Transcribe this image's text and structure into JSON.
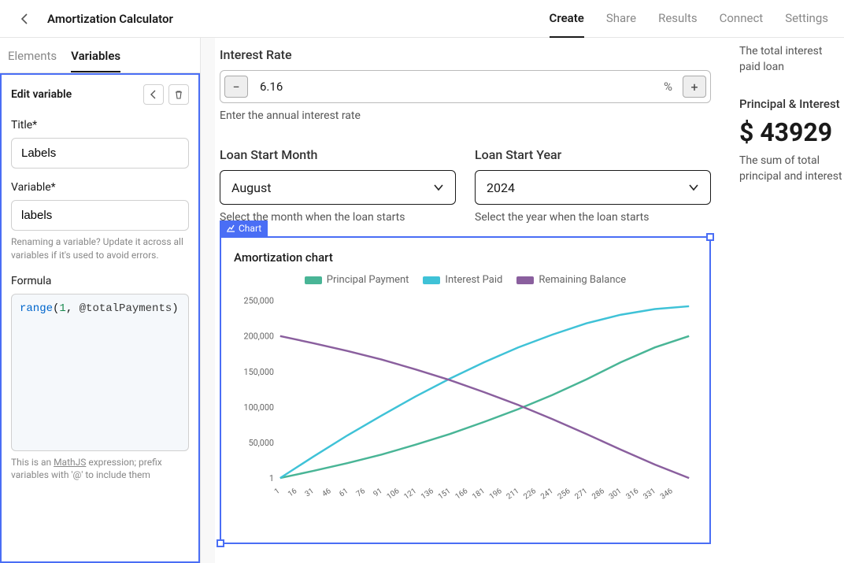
{
  "header": {
    "title": "Amortization Calculator",
    "tabs": [
      "Create",
      "Share",
      "Results",
      "Connect",
      "Settings"
    ],
    "activeTab": "Create"
  },
  "sidebar": {
    "tabs": [
      "Elements",
      "Variables"
    ],
    "activeTab": "Variables",
    "edit": {
      "heading": "Edit variable",
      "titleLabel": "Title*",
      "titleValue": "Labels",
      "variableLabel": "Variable*",
      "variableValue": "labels",
      "variableHint": "Renaming a variable? Update it across all variables if it's used to avoid errors.",
      "formulaLabel": "Formula",
      "formulaTokens": {
        "fn": "range",
        "open": "(",
        "num": "1",
        "comma": ", ",
        "var": "@totalPayments",
        "close": ")"
      },
      "formulaHint1": "This is an ",
      "formulaHintLink": "MathJS",
      "formulaHint2": " expression; prefix variables with '@' to include them"
    }
  },
  "form": {
    "interestRate": {
      "label": "Interest Rate",
      "value": "6.16",
      "unit": "%",
      "hint": "Enter the annual interest rate"
    },
    "month": {
      "label": "Loan Start Month",
      "value": "August",
      "hint": "Select the month when the loan starts"
    },
    "year": {
      "label": "Loan Start Year",
      "value": "2024",
      "hint": "Select the year when the loan starts"
    }
  },
  "chartTag": "Chart",
  "chart_data": {
    "type": "line",
    "title": "Amortization chart",
    "xlabel": "",
    "ylabel": "",
    "ylim": [
      1,
      250000
    ],
    "x_ticks": [
      1,
      16,
      31,
      46,
      61,
      76,
      91,
      106,
      121,
      136,
      151,
      166,
      181,
      196,
      211,
      226,
      241,
      256,
      271,
      286,
      301,
      316,
      331,
      346
    ],
    "y_ticks": [
      1,
      50000,
      100000,
      150000,
      200000,
      250000
    ],
    "series": [
      {
        "name": "Principal Payment",
        "color": "#49b596",
        "values": [
          [
            1,
            1
          ],
          [
            30,
            10000
          ],
          [
            60,
            21000
          ],
          [
            90,
            33000
          ],
          [
            120,
            47000
          ],
          [
            150,
            62000
          ],
          [
            180,
            79000
          ],
          [
            210,
            97000
          ],
          [
            240,
            117000
          ],
          [
            270,
            139000
          ],
          [
            300,
            163000
          ],
          [
            330,
            184000
          ],
          [
            360,
            200000
          ]
        ]
      },
      {
        "name": "Interest Paid",
        "color": "#3fc2d7",
        "values": [
          [
            1,
            1
          ],
          [
            30,
            30000
          ],
          [
            60,
            60000
          ],
          [
            90,
            88000
          ],
          [
            120,
            115000
          ],
          [
            150,
            140000
          ],
          [
            180,
            163000
          ],
          [
            210,
            184000
          ],
          [
            240,
            202000
          ],
          [
            270,
            218000
          ],
          [
            300,
            230000
          ],
          [
            330,
            238000
          ],
          [
            360,
            242000
          ]
        ]
      },
      {
        "name": "Remaining Balance",
        "color": "#8a5f9e",
        "values": [
          [
            1,
            200000
          ],
          [
            30,
            190000
          ],
          [
            60,
            179000
          ],
          [
            90,
            167000
          ],
          [
            120,
            153000
          ],
          [
            150,
            138000
          ],
          [
            180,
            121000
          ],
          [
            210,
            103000
          ],
          [
            240,
            83000
          ],
          [
            270,
            62000
          ],
          [
            300,
            40000
          ],
          [
            330,
            19000
          ],
          [
            360,
            1
          ]
        ]
      }
    ]
  },
  "right": {
    "totalInterestHint": "The total interest paid loan",
    "piLabel": "Principal & Interest",
    "piValue": "$ 43929",
    "piHint": "The sum of total principal and interest"
  }
}
